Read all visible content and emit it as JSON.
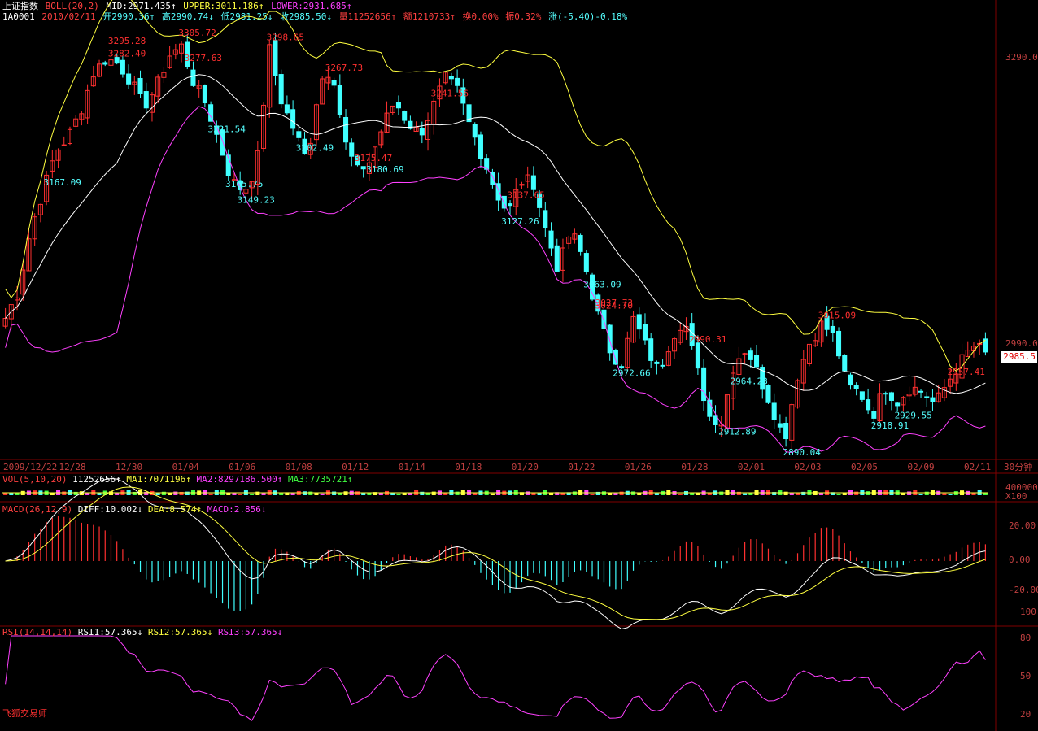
{
  "header": {
    "name": "上证指数",
    "boll_label": "BOLL(20,2)",
    "mid": "MID:2971.435↑",
    "upper": "UPPER:3011.186↑",
    "lower": "LOWER:2931.685↑",
    "code": "1A0001",
    "date": "2010/02/11",
    "open": "开2990.36↑",
    "high": "高2990.74↓",
    "low": "低2981.25↓",
    "close": "收2985.50↓",
    "volume": "量11252656↑",
    "amount": "额1210733↑",
    "turnover": "换0.00%",
    "amplitude": "振0.32%",
    "change": "涨(-5.40)-0.18%"
  },
  "volume_indicator": {
    "label": "VOL(5,10,20)",
    "value": "11252656↑",
    "ma1": "MA1:7071196↑",
    "ma2": "MA2:8297186.500↑",
    "ma3": "MA3:7735721↑"
  },
  "macd_indicator": {
    "label": "MACD(26,12,9)",
    "diff": "DIFF:10.002↓",
    "dea": "DEA:8.574↑",
    "macd": "MACD:2.856↓"
  },
  "rsi_indicator": {
    "label": "RSI(14,14,14)",
    "rsi1": "RSI1:57.365↓",
    "rsi2": "RSI2:57.365↓",
    "rsi3": "RSI3:57.365↓"
  },
  "right_axis": {
    "price_top": "3290.0",
    "price_mid": "2990.0",
    "vol_unit": "30分钟",
    "vol_top": "4000000",
    "vol_scale": "X100",
    "macd_ticks": [
      "20.00",
      "0.00",
      "-20.00"
    ],
    "rsi_ticks": [
      "100",
      "80",
      "50",
      "20"
    ]
  },
  "current_price": "2985.5",
  "watermark": "飞狐交易师",
  "colors": {
    "up": "#ff3030",
    "down": "#40ffff",
    "mid_band": "#ffffff",
    "upper_band": "#ffff40",
    "lower_band": "#ff40ff",
    "rsi": "#ff40ff"
  },
  "chart_data": [
    {
      "type": "candlestick",
      "title": "上证指数 BOLL(20,2)",
      "timeframe": "30分钟",
      "x_ticks": [
        "2009/12/22",
        "12/28",
        "12/30",
        "01/04",
        "01/06",
        "01/08",
        "01/12",
        "01/14",
        "01/18",
        "01/20",
        "01/22",
        "01/26",
        "01/28",
        "02/01",
        "02/03",
        "02/05",
        "02/09",
        "02/11"
      ],
      "ylim": [
        2880,
        3320
      ],
      "close_path": [
        [
          "2009/12/22",
          3020
        ],
        [
          "2009/12/22",
          3048
        ],
        [
          "12/24",
          3110
        ],
        [
          "12/25",
          3150
        ],
        [
          "12/28",
          3190
        ],
        [
          "12/28",
          3205
        ],
        [
          "12/29",
          3232
        ],
        [
          "12/30",
          3270
        ],
        [
          "12/31",
          3285
        ],
        [
          "01/04",
          3280
        ],
        [
          "01/04",
          3262
        ],
        [
          "01/05",
          3236
        ],
        [
          "01/05",
          3255
        ],
        [
          "01/06",
          3288
        ],
        [
          "01/06",
          3298
        ],
        [
          "01/07",
          3260
        ],
        [
          "01/07",
          3238
        ],
        [
          "01/08",
          3200
        ],
        [
          "01/08",
          3160
        ],
        [
          "01/08",
          3150
        ],
        [
          "01/08",
          3175
        ],
        [
          "01/11",
          3295
        ],
        [
          "01/11",
          3240
        ],
        [
          "01/11",
          3212
        ],
        [
          "01/12",
          3180
        ],
        [
          "01/12",
          3262
        ],
        [
          "01/13",
          3276
        ],
        [
          "01/13",
          3200
        ],
        [
          "01/14",
          3170
        ],
        [
          "01/14",
          3180
        ],
        [
          "01/15",
          3215
        ],
        [
          "01/15",
          3242
        ],
        [
          "01/18",
          3220
        ],
        [
          "01/18",
          3208
        ],
        [
          "01/19",
          3235
        ],
        [
          "01/19",
          3265
        ],
        [
          "01/20",
          3252
        ],
        [
          "01/20",
          3215
        ],
        [
          "01/21",
          3185
        ],
        [
          "01/21",
          3150
        ],
        [
          "01/22",
          3127
        ],
        [
          "01/22",
          3160
        ],
        [
          "01/22",
          3160
        ],
        [
          "01/25",
          3110
        ],
        [
          "01/25",
          3070
        ],
        [
          "01/26",
          3110
        ],
        [
          "01/26",
          3080
        ],
        [
          "01/26",
          3030
        ],
        [
          "01/27",
          2990
        ],
        [
          "01/27",
          2972
        ],
        [
          "01/28",
          3020
        ],
        [
          "01/28",
          2990
        ],
        [
          "01/28",
          2965
        ],
        [
          "01/29",
          3000
        ],
        [
          "01/29",
          3020
        ],
        [
          "02/01",
          2970
        ],
        [
          "02/01",
          2920
        ],
        [
          "02/02",
          2915
        ],
        [
          "02/02",
          2975
        ],
        [
          "02/02",
          2990
        ],
        [
          "02/02",
          2960
        ],
        [
          "02/03",
          2930
        ],
        [
          "02/03",
          2895
        ],
        [
          "02/03",
          2960
        ],
        [
          "02/04",
          2995
        ],
        [
          "02/04",
          3015
        ],
        [
          "02/05",
          3000
        ],
        [
          "02/05",
          2950
        ],
        [
          "02/08",
          2945
        ],
        [
          "02/08",
          2920
        ],
        [
          "02/08",
          2950
        ],
        [
          "02/09",
          2935
        ],
        [
          "02/09",
          2950
        ],
        [
          "02/09",
          2945
        ],
        [
          "02/10",
          2932
        ],
        [
          "02/10",
          2955
        ],
        [
          "02/10",
          2975
        ],
        [
          "02/11",
          2992
        ],
        [
          "02/11",
          2985.5
        ]
      ],
      "annotations": [
        {
          "label": "3295.28",
          "color": "red"
        },
        {
          "label": "3282.40",
          "color": "red"
        },
        {
          "label": "3167.09",
          "color": "cyan"
        },
        {
          "label": "3221.54",
          "color": "cyan"
        },
        {
          "label": "3298.65",
          "color": "red"
        },
        {
          "label": "3305.72",
          "color": "red"
        },
        {
          "label": "3149.23",
          "color": "cyan"
        },
        {
          "label": "3180.69",
          "color": "cyan"
        },
        {
          "label": "3277.63",
          "color": "red"
        },
        {
          "label": "3165.75",
          "color": "cyan"
        },
        {
          "label": "3241.56",
          "color": "red"
        },
        {
          "label": "3202.49",
          "color": "cyan"
        },
        {
          "label": "3267.73",
          "color": "red"
        },
        {
          "label": "3175.47",
          "color": "red"
        },
        {
          "label": "3127.26",
          "color": "cyan"
        },
        {
          "label": "3137.65",
          "color": "red"
        },
        {
          "label": "3063.09",
          "color": "cyan"
        },
        {
          "label": "3027.73",
          "color": "red"
        },
        {
          "label": "3024.70",
          "color": "red"
        },
        {
          "label": "2972.66",
          "color": "cyan"
        },
        {
          "label": "2964.23",
          "color": "cyan"
        },
        {
          "label": "2990.31",
          "color": "red"
        },
        {
          "label": "2912.89",
          "color": "cyan"
        },
        {
          "label": "2890.04",
          "color": "cyan"
        },
        {
          "label": "3015.09",
          "color": "red"
        },
        {
          "label": "2957.41",
          "color": "red"
        },
        {
          "label": "2918.91",
          "color": "cyan"
        },
        {
          "label": "2929.55",
          "color": "cyan"
        }
      ],
      "bands": {
        "mid": 2971.435,
        "upper": 3011.186,
        "lower": 2931.685
      }
    },
    {
      "type": "bar",
      "title": "VOL(5,10,20)",
      "values_note": "volume bars, latest 11252656"
    },
    {
      "type": "bar",
      "title": "MACD(26,12,9)",
      "ylim": [
        -30,
        30
      ],
      "series": [
        {
          "name": "DIFF",
          "latest": 10.002
        },
        {
          "name": "DEA",
          "latest": 8.574
        },
        {
          "name": "MACD",
          "latest": 2.856
        }
      ]
    },
    {
      "type": "line",
      "title": "RSI(14,14,14)",
      "ylim": [
        20,
        100
      ],
      "series": [
        {
          "name": "RSI1",
          "latest": 57.365
        }
      ]
    }
  ]
}
